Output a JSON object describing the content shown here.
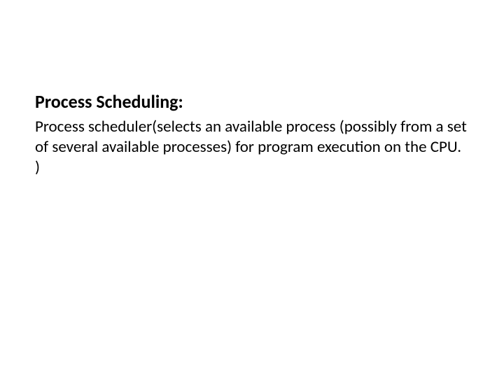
{
  "slide": {
    "heading": "Process Scheduling:",
    "body": "Process scheduler(selects an available process (possibly from a set of several available processes) for program execution on the CPU. )"
  }
}
